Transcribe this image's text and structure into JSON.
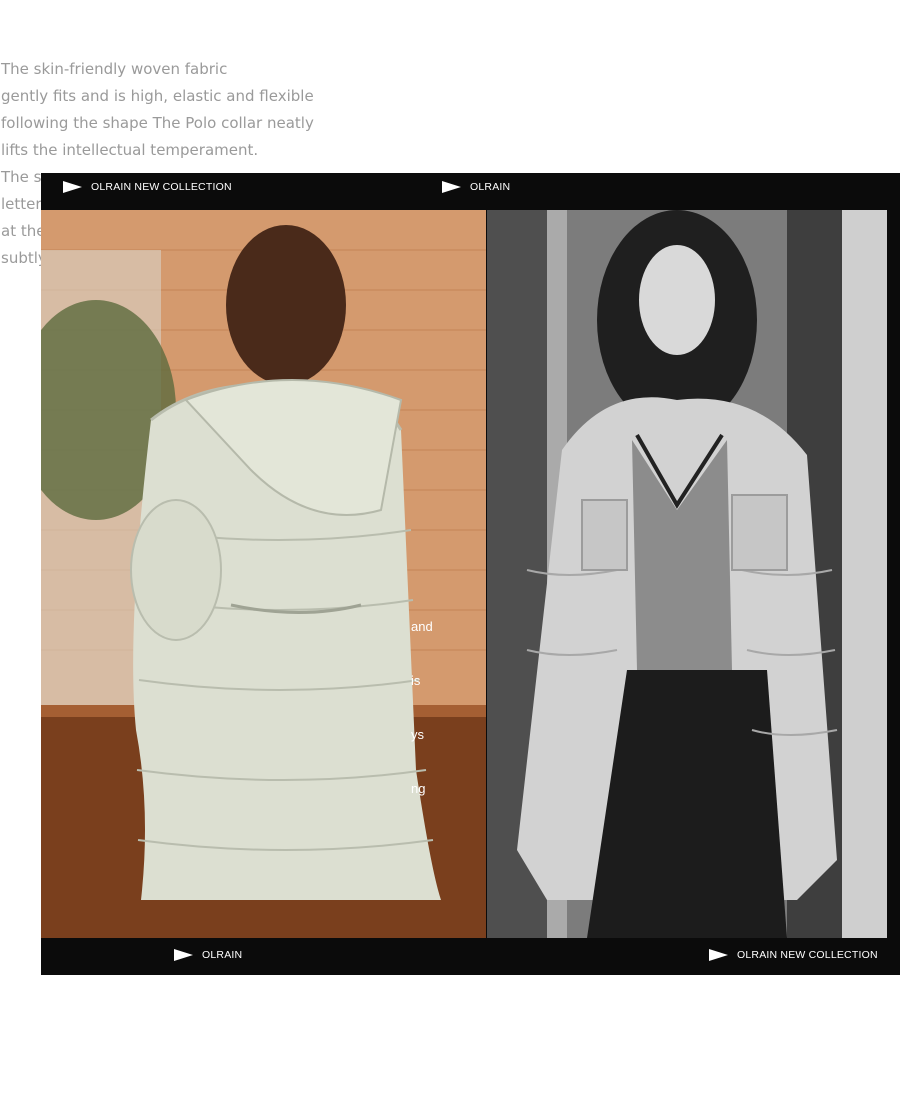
{
  "intro_text": [
    "The skin-friendly woven fabric",
    "gently fits and is high, elastic and flexible",
    "following the shape The Polo collar neatly",
    "lifts the intellectual temperament.",
    "The s",
    "letter",
    "at the",
    "subtly"
  ],
  "film": {
    "top_left_label": "OLRAIN NEW COLLECTION",
    "top_right_label": "OLRAIN",
    "bottom_left_label": "OLRAIN",
    "bottom_right_label": "OLRAIN NEW COLLECTION"
  },
  "photo_left": {
    "caption_lines": [
      "and",
      "is",
      "ys",
      "ng"
    ]
  },
  "colors": {
    "frame": "#0b0b0b",
    "intro_text": "#9a9a9a",
    "label": "#ffffff"
  }
}
